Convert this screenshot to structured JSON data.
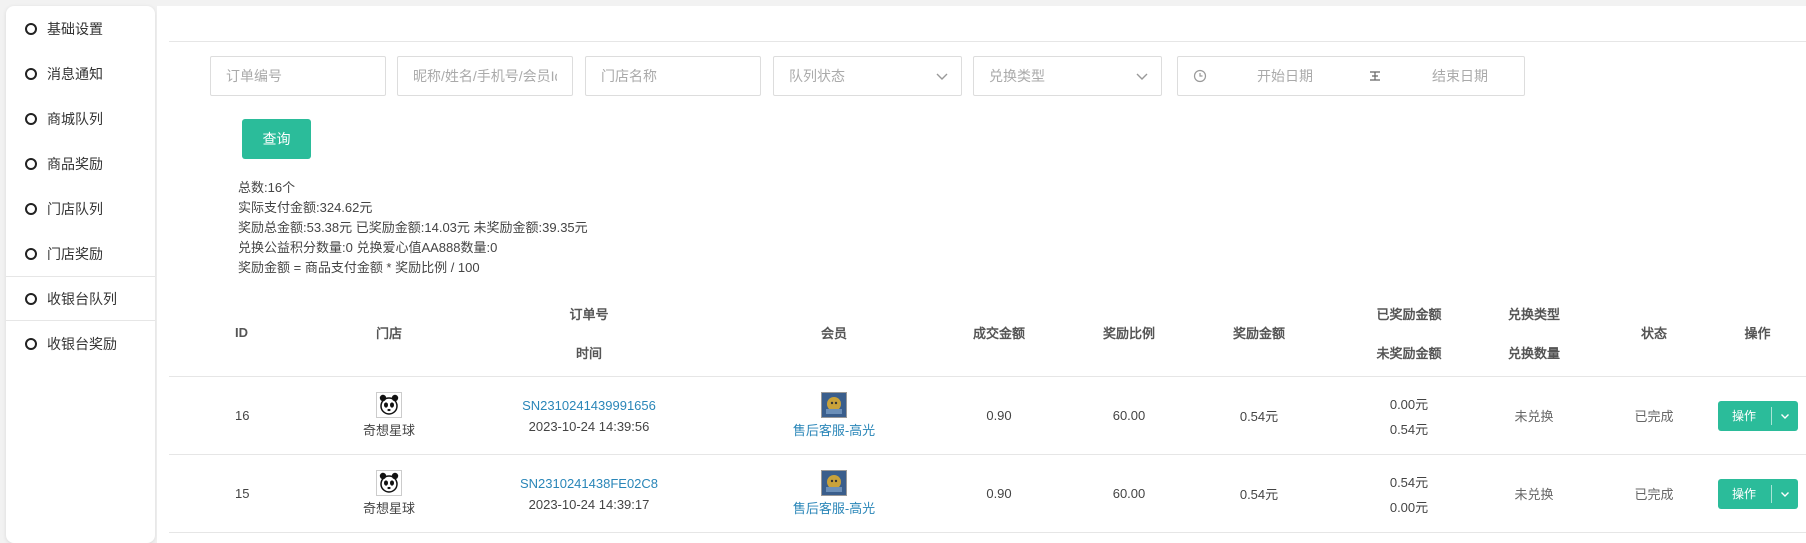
{
  "sidebar": {
    "items": [
      {
        "label": "基础设置"
      },
      {
        "label": "消息通知"
      },
      {
        "label": "商城队列"
      },
      {
        "label": "商品奖励"
      },
      {
        "label": "门店队列"
      },
      {
        "label": "门店奖励"
      },
      {
        "label": "收银台队列"
      },
      {
        "label": "收银台奖励"
      }
    ],
    "active_index": 6
  },
  "filters": {
    "order_no_placeholder": "订单编号",
    "member_placeholder": "昵称/姓名/手机号/会员Id",
    "store_placeholder": "门店名称",
    "queue_status_placeholder": "队列状态",
    "exchange_type_placeholder": "兑换类型",
    "start_date_placeholder": "开始日期",
    "end_date_placeholder": "结束日期",
    "query_label": "查询"
  },
  "summary": {
    "line1": "总数:16个",
    "line2": "实际支付金额:324.62元",
    "line3": "奖励总金额:53.38元 已奖励金额:14.03元 未奖励金额:39.35元",
    "line4": "兑换公益积分数量:0 兑换爱心值AA888数量:0",
    "line5": "奖励金额 = 商品支付金额 * 奖励比例 / 100"
  },
  "table": {
    "headers": {
      "id": "ID",
      "store": "门店",
      "order_no": "订单号",
      "time": "时间",
      "member": "会员",
      "deal_amount": "成交金额",
      "reward_ratio": "奖励比例",
      "reward_amount": "奖励金额",
      "rewarded": "已奖励金额",
      "unrewarded": "未奖励金额",
      "exchange_type": "兑换类型",
      "exchange_qty": "兑换数量",
      "status": "状态",
      "action": "操作"
    },
    "rows": [
      {
        "id": "16",
        "store": "奇想星球",
        "order_no": "SN2310241439991656",
        "time": "2023-10-24 14:39:56",
        "member": "售后客服-高光",
        "deal_amount": "0.90",
        "reward_ratio": "60.00",
        "reward_amount": "0.54元",
        "rewarded": "0.00元",
        "unrewarded": "0.54元",
        "exchange_type": "未兑换",
        "status": "已完成",
        "action": "操作"
      },
      {
        "id": "15",
        "store": "奇想星球",
        "order_no": "SN2310241438FE02C8",
        "time": "2023-10-24 14:39:17",
        "member": "售后客服-高光",
        "deal_amount": "0.90",
        "reward_ratio": "60.00",
        "reward_amount": "0.54元",
        "rewarded": "0.54元",
        "unrewarded": "0.00元",
        "exchange_type": "未兑换",
        "status": "已完成",
        "action": "操作"
      }
    ]
  },
  "colors": {
    "accent": "#2bbc9a",
    "link": "#2a86b8"
  }
}
